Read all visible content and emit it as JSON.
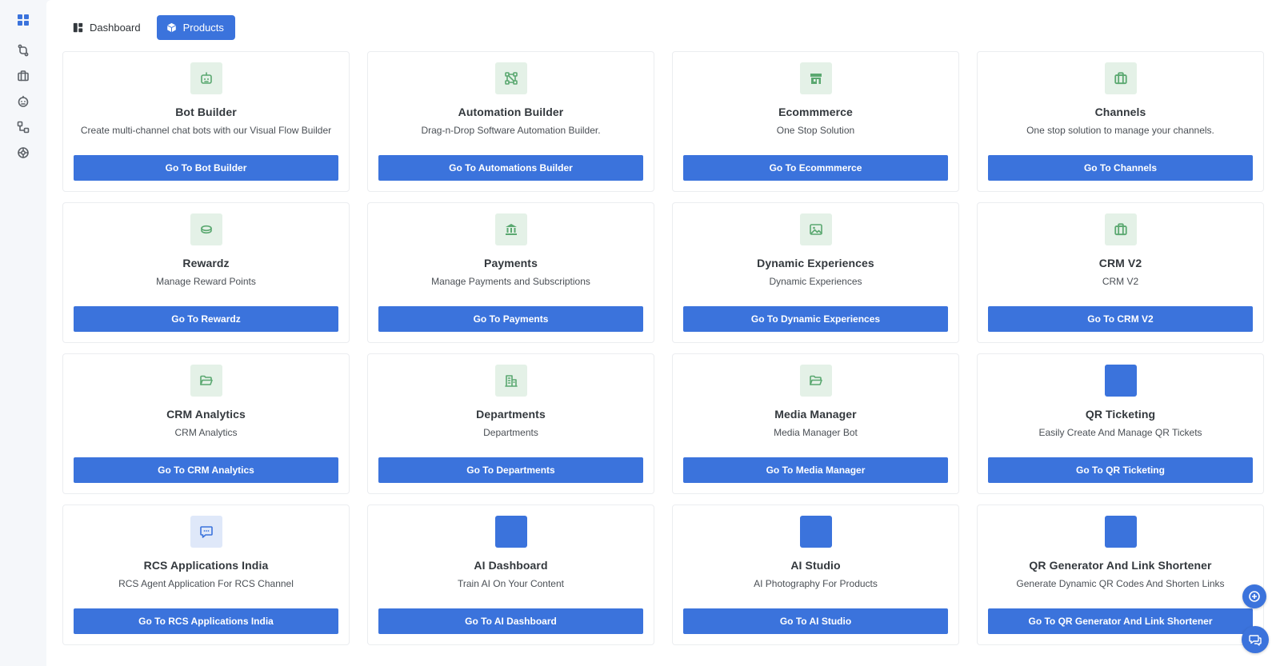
{
  "sidebar": {
    "icons": [
      "grid-logo-icon",
      "routes-icon",
      "briefcase-icon",
      "bot-face-icon",
      "flow-nodes-icon",
      "settings-circle-icon"
    ]
  },
  "tabs": [
    {
      "label": "Dashboard",
      "icon": "dashboard-icon",
      "active": false
    },
    {
      "label": "Products",
      "icon": "cube-icon",
      "active": true
    }
  ],
  "cards": [
    {
      "title": "Bot Builder",
      "desc": "Create multi-channel chat bots with our Visual Flow Builder",
      "button": "Go To Bot Builder",
      "icon": "robot-icon",
      "icon_style": "green"
    },
    {
      "title": "Automation Builder",
      "desc": "Drag-n-Drop Software Automation Builder.",
      "button": "Go To Automations Builder",
      "icon": "workflow-icon",
      "icon_style": "green"
    },
    {
      "title": "Ecommmerce",
      "desc": "One Stop Solution",
      "button": "Go To Ecommmerce",
      "icon": "storefront-icon",
      "icon_style": "green"
    },
    {
      "title": "Channels",
      "desc": "One stop solution to manage your channels.",
      "button": "Go To Channels",
      "icon": "briefcase-icon",
      "icon_style": "green"
    },
    {
      "title": "Rewardz",
      "desc": "Manage Reward Points",
      "button": "Go To Rewardz",
      "icon": "coins-icon",
      "icon_style": "green"
    },
    {
      "title": "Payments",
      "desc": "Manage Payments and Subscriptions",
      "button": "Go To Payments",
      "icon": "bank-icon",
      "icon_style": "green"
    },
    {
      "title": "Dynamic Experiences",
      "desc": "Dynamic Experiences",
      "button": "Go To Dynamic Experiences",
      "icon": "image-icon",
      "icon_style": "green"
    },
    {
      "title": "CRM V2",
      "desc": "CRM V2",
      "button": "Go To CRM V2",
      "icon": "briefcase-icon",
      "icon_style": "green"
    },
    {
      "title": "CRM Analytics",
      "desc": "CRM Analytics",
      "button": "Go To CRM Analytics",
      "icon": "folder-open-icon",
      "icon_style": "green"
    },
    {
      "title": "Departments",
      "desc": "Departments",
      "button": "Go To Departments",
      "icon": "building-icon",
      "icon_style": "green"
    },
    {
      "title": "Media Manager",
      "desc": "Media Manager Bot",
      "button": "Go To Media Manager",
      "icon": "folder-open-icon",
      "icon_style": "green"
    },
    {
      "title": "QR Ticketing",
      "desc": "Easily Create And Manage QR Tickets",
      "button": "Go To QR Ticketing",
      "icon": "blank-square-icon",
      "icon_style": "blue"
    },
    {
      "title": "RCS Applications India",
      "desc": "RCS Agent Application For RCS Channel",
      "button": "Go To RCS Applications India",
      "icon": "chat-bubble-icon",
      "icon_style": "lightblue"
    },
    {
      "title": "AI Dashboard",
      "desc": "Train AI On Your Content",
      "button": "Go To AI Dashboard",
      "icon": "blank-square-icon",
      "icon_style": "blue"
    },
    {
      "title": "AI Studio",
      "desc": "AI Photography For Products",
      "button": "Go To AI Studio",
      "icon": "blank-square-icon",
      "icon_style": "blue"
    },
    {
      "title": "QR Generator And Link Shortener",
      "desc": "Generate Dynamic QR Codes And Shorten Links",
      "button": "Go To QR Generator And Link Shortener",
      "icon": "blank-square-icon",
      "icon_style": "blue"
    }
  ],
  "floating": {
    "top_icon": "plus-circle-icon",
    "bottom_icon": "chat-icon"
  },
  "colors": {
    "accent": "#3b73dc",
    "icon_green": "#5aa870",
    "icon_green_bg": "#e4f1e7",
    "sidebar_active": "#3b73dc",
    "sidebar_icon": "#5c6167"
  }
}
